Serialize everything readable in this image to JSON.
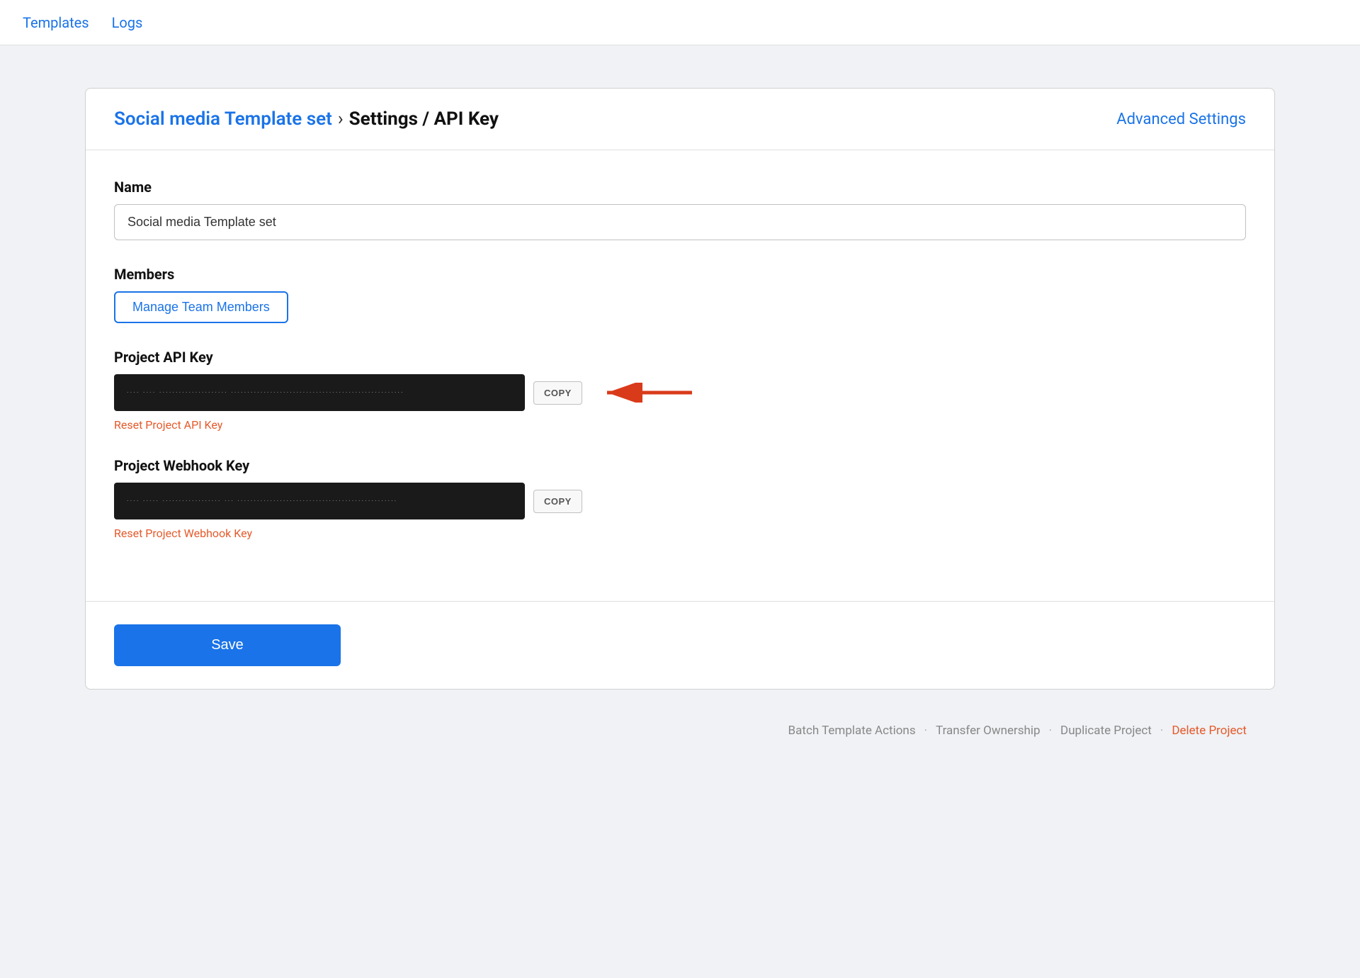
{
  "nav": {
    "links": [
      {
        "id": "templates",
        "label": "Templates"
      },
      {
        "id": "logs",
        "label": "Logs"
      }
    ]
  },
  "header": {
    "breadcrumb_link": "Social media Template set",
    "breadcrumb_separator": "›",
    "breadcrumb_current": "Settings / API Key",
    "advanced_settings_label": "Advanced Settings"
  },
  "form": {
    "name_label": "Name",
    "name_value": "Social media Template set",
    "name_placeholder": "Social media Template set",
    "members_label": "Members",
    "manage_team_label": "Manage Team Members",
    "api_key_label": "Project API Key",
    "api_key_masked": "···· ···· ····················· ·····················································",
    "api_key_copy_label": "COPY",
    "reset_api_key_label": "Reset Project API Key",
    "webhook_key_label": "Project Webhook Key",
    "webhook_key_masked": "···· ····· ·················· ··· ·················································",
    "webhook_key_copy_label": "COPY",
    "reset_webhook_key_label": "Reset Project Webhook Key"
  },
  "footer": {
    "save_label": "Save"
  },
  "bottom_actions": {
    "batch_label": "Batch Template Actions",
    "transfer_label": "Transfer Ownership",
    "duplicate_label": "Duplicate Project",
    "delete_label": "Delete Project",
    "separator": "·"
  },
  "colors": {
    "accent": "#1a73e8",
    "danger": "#e55a2b",
    "arrow_red": "#d93b1a"
  }
}
